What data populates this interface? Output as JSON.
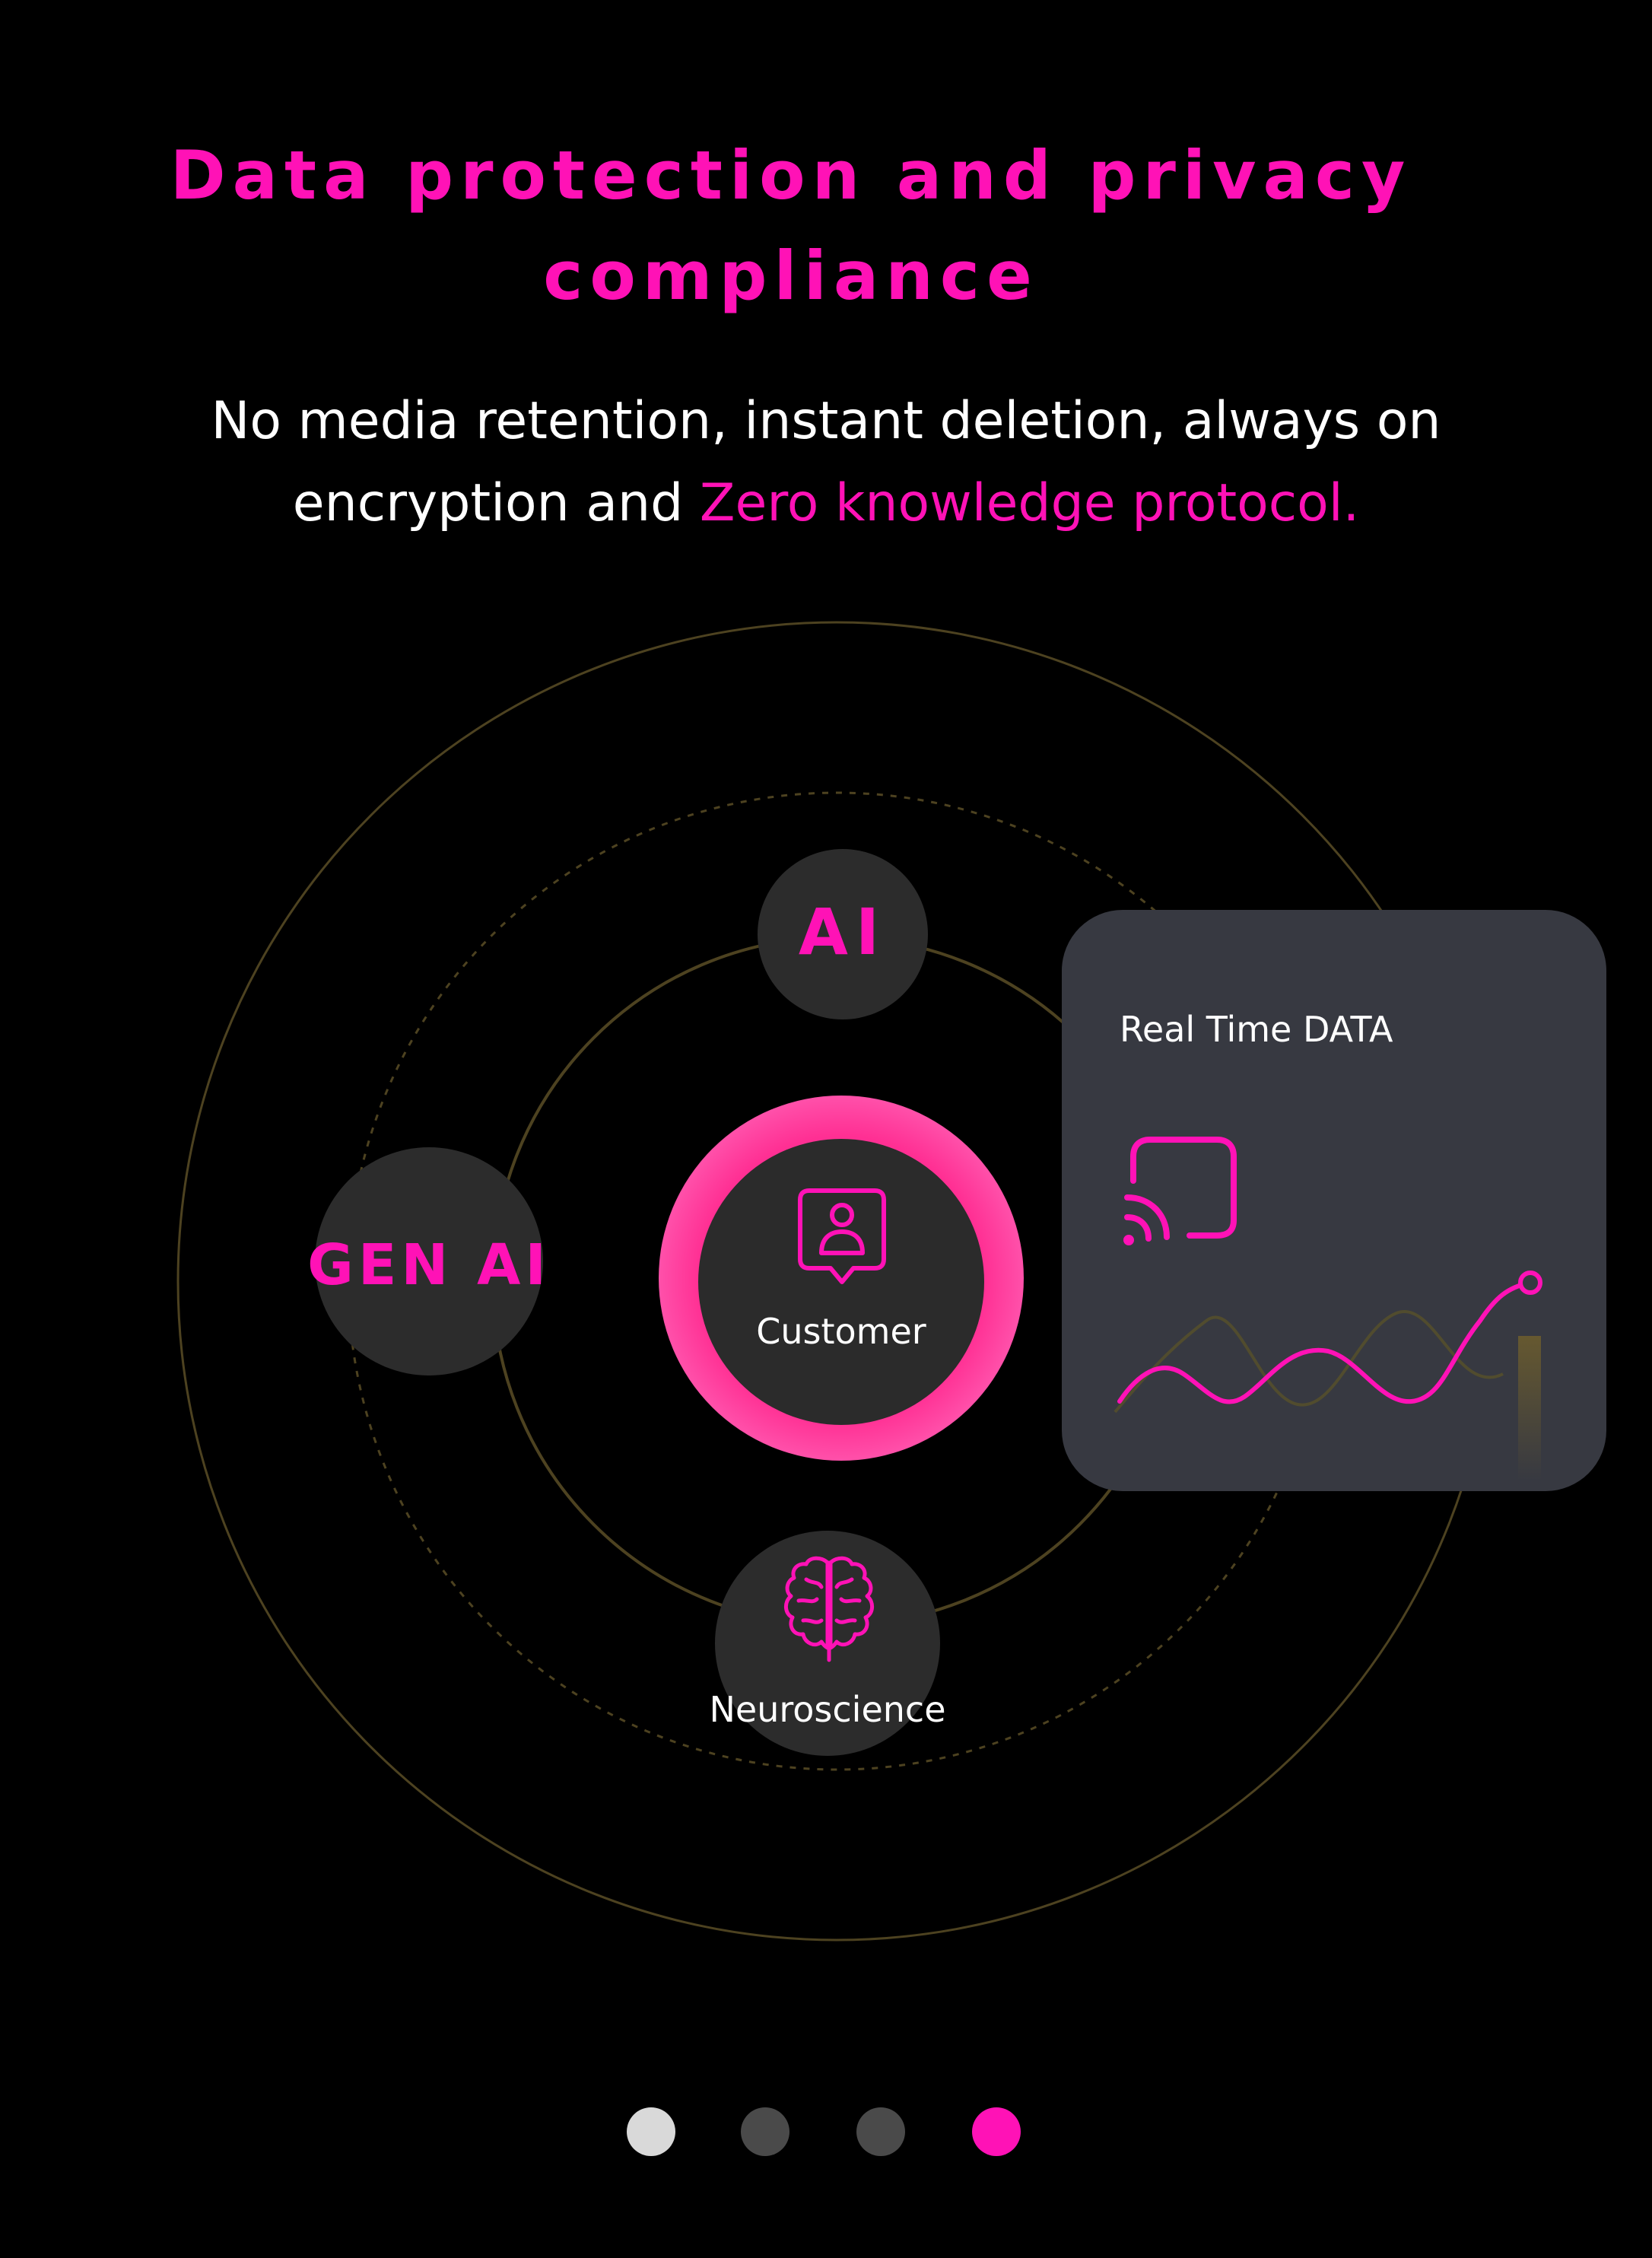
{
  "headline": {
    "line1": "Data protection and privacy",
    "line2": "compliance"
  },
  "subtitle": {
    "line1": "No media retention, instant deletion, always on",
    "line2_plain": "encryption and",
    "line2_highlight": "Zero knowledge protocol."
  },
  "diagram": {
    "nodes": {
      "top": "AI",
      "left": "GEN AI",
      "bottom": "Neuroscience",
      "center": "Customer"
    },
    "icons": {
      "center": "customer-profile-icon",
      "bottom": "brain-icon",
      "card": "cast-signal-icon"
    }
  },
  "card": {
    "title": "Real Time DATA"
  },
  "pagination": {
    "count": 4,
    "active_index": 3
  },
  "colors": {
    "accent": "#ff12b6",
    "orbit": "#5a4a1f",
    "node_bg": "#2c2c2c",
    "card_bg": "#373941",
    "dot_inactive": "#4a4a4a",
    "dot_first": "#d9d9d9"
  }
}
